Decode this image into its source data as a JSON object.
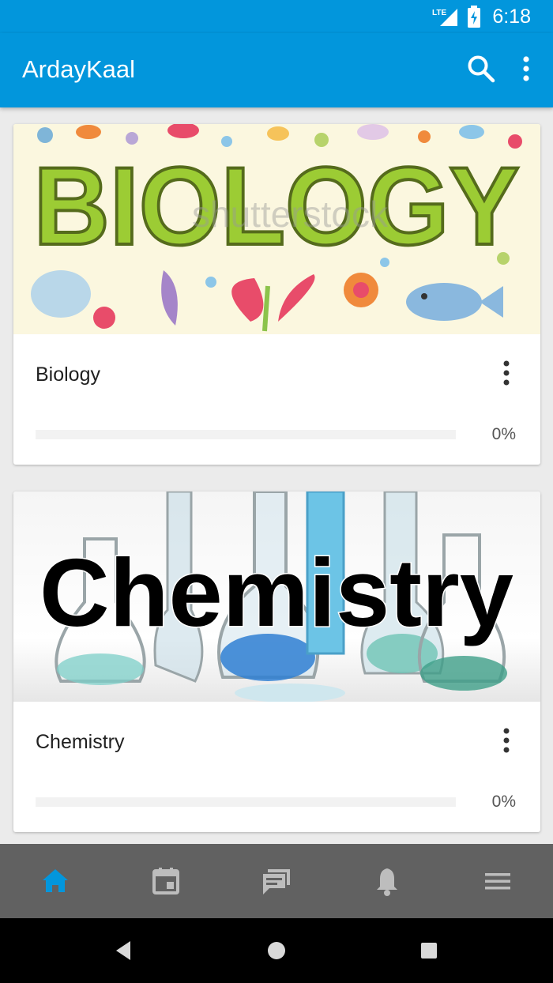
{
  "status_bar": {
    "network": "LTE",
    "time": "6:18"
  },
  "app_bar": {
    "title": "ArdayKaal"
  },
  "courses": [
    {
      "title": "Biology",
      "progress_percent": 0,
      "progress_label": "0%",
      "image_text": "BIOLOGY",
      "watermark": "shutterstock"
    },
    {
      "title": "Chemistry",
      "progress_percent": 0,
      "progress_label": "0%",
      "image_text": "Chemistry"
    }
  ],
  "bottom_nav": {
    "items": [
      "home-icon",
      "calendar-icon",
      "chat-icon",
      "bell-icon",
      "menu-icon"
    ],
    "active_index": 0
  },
  "colors": {
    "primary": "#0296dc",
    "nav_bg": "#616161",
    "nav_icon": "#bdbdbd",
    "nav_active": "#0296dc"
  }
}
